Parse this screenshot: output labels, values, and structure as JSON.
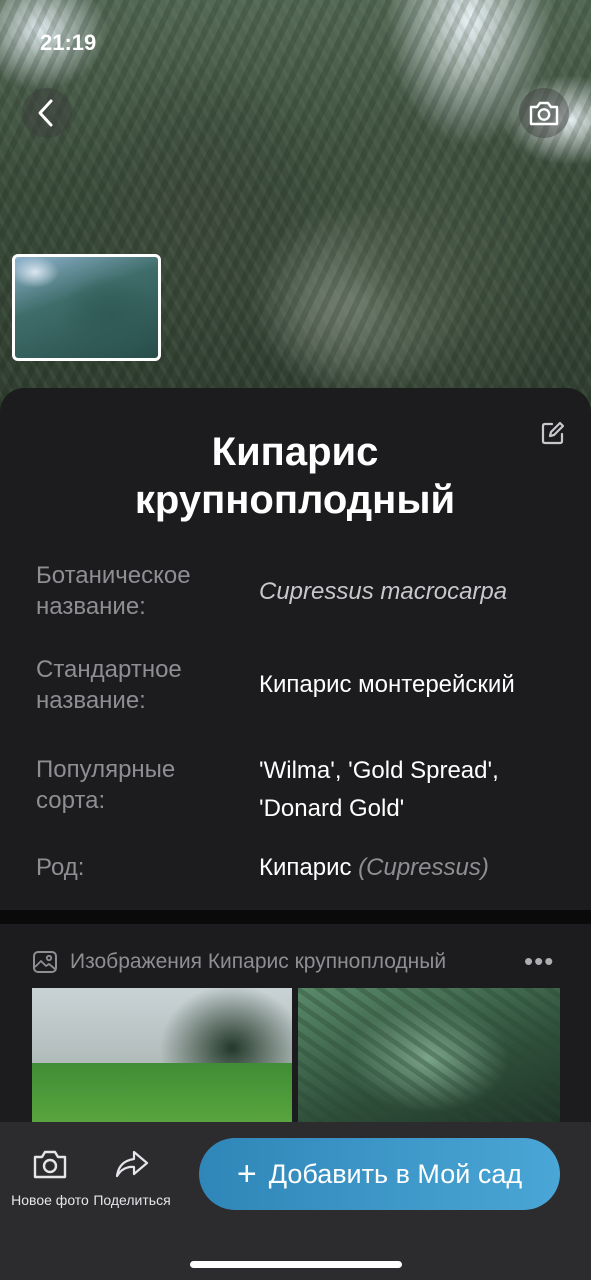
{
  "status_bar": {
    "time": "21:19"
  },
  "plant": {
    "title": "Кипарис крупноплодный",
    "details": [
      {
        "label": "Ботаническое название:",
        "value": "Cupressus macrocarpa"
      },
      {
        "label": "Стандартное название:",
        "value": "Кипарис монтерейский"
      },
      {
        "label": "Популярные сорта:",
        "value": "'Wilma', 'Gold Spread', 'Donard Gold'"
      },
      {
        "label": "Род:",
        "value": "Кипарис",
        "value_sub": "(Cupressus)"
      }
    ]
  },
  "gallery": {
    "title": "Изображения Кипарис крупноплодный",
    "more": "•••"
  },
  "bottom_bar": {
    "new_photo": "Новое фото",
    "share": "Поделиться",
    "add_button": "Добавить в Мой сад"
  },
  "icons": {
    "back": "chevron-left-icon",
    "camera": "camera-icon",
    "edit": "edit-icon",
    "gallery": "image-icon",
    "share": "share-icon",
    "plus": "plus-icon"
  },
  "colors": {
    "accent": "#3a9ad0",
    "sheet": "#1c1c1e",
    "bar": "#2c2c2e",
    "label": "#8e8e93"
  }
}
